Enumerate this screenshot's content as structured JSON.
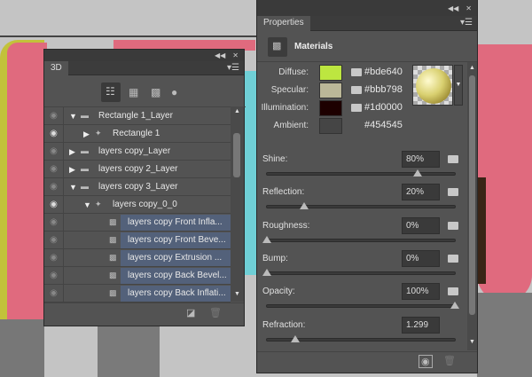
{
  "panel_3d": {
    "tab": "3D",
    "toolbar_icons": [
      "scene-icon",
      "mesh-icon",
      "materials-icon",
      "light-icon"
    ],
    "rows": [
      {
        "label": "Rectangle 1_Layer",
        "indent": 0,
        "expand": "open",
        "type": "folder",
        "eye": false
      },
      {
        "label": "Rectangle 1",
        "indent": 1,
        "expand": "closed",
        "type": "mesh",
        "eye": true
      },
      {
        "label": "layers copy_Layer",
        "indent": 0,
        "expand": "closed",
        "type": "folder",
        "eye": false
      },
      {
        "label": "layers copy 2_Layer",
        "indent": 0,
        "expand": "closed",
        "type": "folder",
        "eye": false
      },
      {
        "label": "layers copy 3_Layer",
        "indent": 0,
        "expand": "open",
        "type": "folder",
        "eye": false
      },
      {
        "label": "layers copy_0_0",
        "indent": 1,
        "expand": "open",
        "type": "mesh",
        "eye": true
      },
      {
        "label": "layers copy Front Infla...",
        "indent": 2,
        "type": "material",
        "selected": true,
        "eye": false
      },
      {
        "label": "layers copy Front Beve...",
        "indent": 2,
        "type": "material",
        "selected": true,
        "eye": false
      },
      {
        "label": "layers copy Extrusion ...",
        "indent": 2,
        "type": "material",
        "selected": true,
        "eye": false
      },
      {
        "label": "layers copy Back Bevel...",
        "indent": 2,
        "type": "material",
        "selected": true,
        "eye": false
      },
      {
        "label": "layers copy Back Inflati...",
        "indent": 2,
        "type": "material",
        "selected": true,
        "eye": false
      }
    ]
  },
  "properties": {
    "tab": "Properties",
    "section": "Materials",
    "colors": [
      {
        "label": "Diffuse:",
        "hex": "#bde640",
        "text": "#bde640",
        "folder": true
      },
      {
        "label": "Specular:",
        "hex": "#bbb798",
        "text": "#bbb798",
        "folder": true
      },
      {
        "label": "Illumination:",
        "hex": "#1d0000",
        "text": "#1d0000",
        "folder": true
      },
      {
        "label": "Ambient:",
        "hex": "#454545",
        "text": "#454545",
        "folder": false
      }
    ],
    "sliders": [
      {
        "label": "Shine:",
        "value": "80%",
        "fraction": 0.8,
        "folder": true
      },
      {
        "label": "Reflection:",
        "value": "20%",
        "fraction": 0.2,
        "folder": true
      },
      {
        "label": "Roughness:",
        "value": "0%",
        "fraction": 0,
        "folder": true
      },
      {
        "label": "Bump:",
        "value": "0%",
        "fraction": 0,
        "folder": true
      },
      {
        "label": "Opacity:",
        "value": "100%",
        "fraction": 1,
        "folder": true
      },
      {
        "label": "Refraction:",
        "value": "1.299",
        "fraction": 0.15,
        "folder": false
      }
    ]
  }
}
